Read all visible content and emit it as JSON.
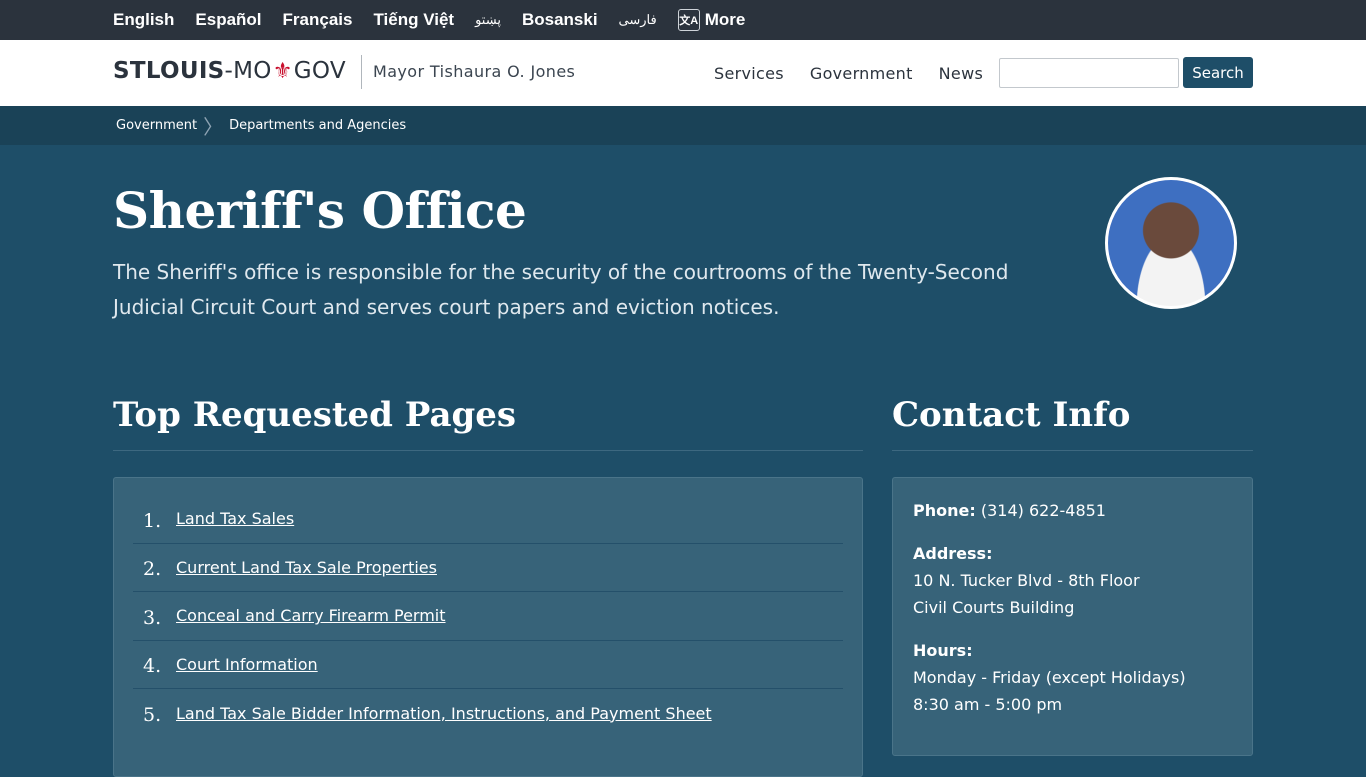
{
  "languages": [
    "English",
    "Español",
    "Français",
    "Tiếng Việt",
    "پښتو",
    "Bosanski",
    "فارسی"
  ],
  "more_label": "More",
  "translate_icon_glyph": "文A",
  "logo": {
    "part1": "STLOUIS",
    "part2": "-MO",
    "fleur": "⚜",
    "part3": "GOV"
  },
  "mayor": "Mayor Tishaura O. Jones",
  "nav": [
    "Services",
    "Government",
    "News"
  ],
  "search": {
    "value": "",
    "button": "Search"
  },
  "breadcrumb": [
    "Government",
    "Departments and Agencies"
  ],
  "page": {
    "title": "Sheriff's Office",
    "intro": "The Sheriff's office is responsible for the security of the courtrooms of the Twenty-Second Judicial Circuit Court and serves court papers and eviction notices."
  },
  "top_requested": {
    "heading": "Top Requested Pages",
    "items": [
      {
        "num": "1.",
        "label": "Land Tax Sales"
      },
      {
        "num": "2.",
        "label": "Current Land Tax Sale Properties"
      },
      {
        "num": "3.",
        "label": "Conceal and Carry Firearm Permit"
      },
      {
        "num": "4.",
        "label": "Court Information"
      },
      {
        "num": "5.",
        "label": "Land Tax Sale Bidder Information, Instructions, and Payment Sheet"
      }
    ]
  },
  "contact": {
    "heading": "Contact Info",
    "phone_label": "Phone:",
    "phone": "(314) 622-4851",
    "address_label": "Address:",
    "address_line1": "10 N. Tucker Blvd - 8th Floor",
    "address_line2": "Civil Courts Building",
    "hours_label": "Hours:",
    "hours_line1": "Monday - Friday (except Holidays)",
    "hours_line2": "8:30 am - 5:00 pm"
  },
  "colors": {
    "accent": "#1e4e68",
    "fleur": "#c8102e",
    "langbar": "#2b333d"
  }
}
